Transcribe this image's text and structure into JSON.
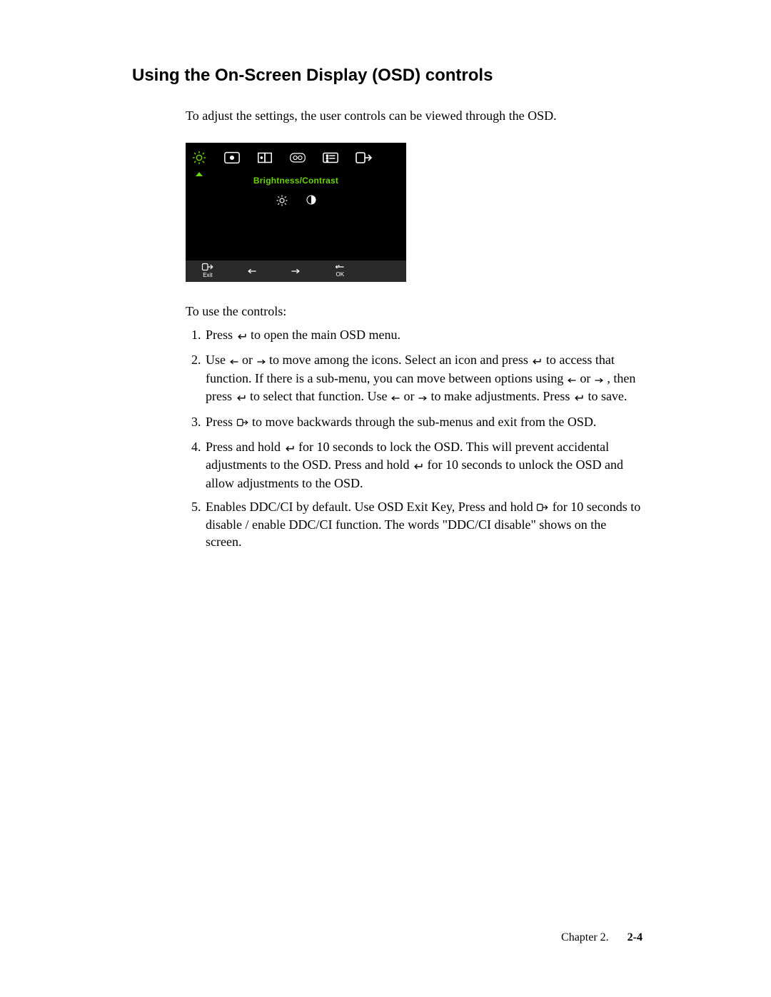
{
  "title": "Using the On-Screen Display (OSD) controls",
  "intro": "To adjust the settings,  the user controls can be viewed through the OSD.",
  "osd": {
    "label": "Brightness/Contrast",
    "bottom": {
      "exit": "Exit",
      "ok": "OK"
    }
  },
  "after": "To use the controls:",
  "steps": {
    "s1a": "Press ",
    "s1b": " to open the main OSD menu.",
    "s2a": "Use ",
    "s2b": " or ",
    "s2c": " to move among the icons. Select an icon and press ",
    "s2d": " to access that function. If there is a sub-menu, you can move between options using ",
    "s2e": " or ",
    "s2f": " , then press ",
    "s2g": " to select that function. Use ",
    "s2h": " or ",
    "s2i": " to make adjustments. Press ",
    "s2j": " to save.",
    "s3a": "Press ",
    "s3b": " to move backwards through the sub-menus and exit from the OSD.",
    "s4a": "Press and hold  ",
    "s4b": "  for 10 seconds to lock the OSD. This will prevent accidental adjustments to the OSD. Press and hold  ",
    "s4c": "  for 10 seconds to unlock the OSD and allow adjustments to the OSD.",
    "s5a": "Enables DDC/CI by default. Use OSD Exit Key,  Press and hold ",
    "s5b": " for 10 seconds  to disable / enable DDC/CI function. The words \"DDC/CI disable\" shows on the screen."
  },
  "footer": {
    "chapter": "Chapter 2.",
    "page": "2-4"
  }
}
